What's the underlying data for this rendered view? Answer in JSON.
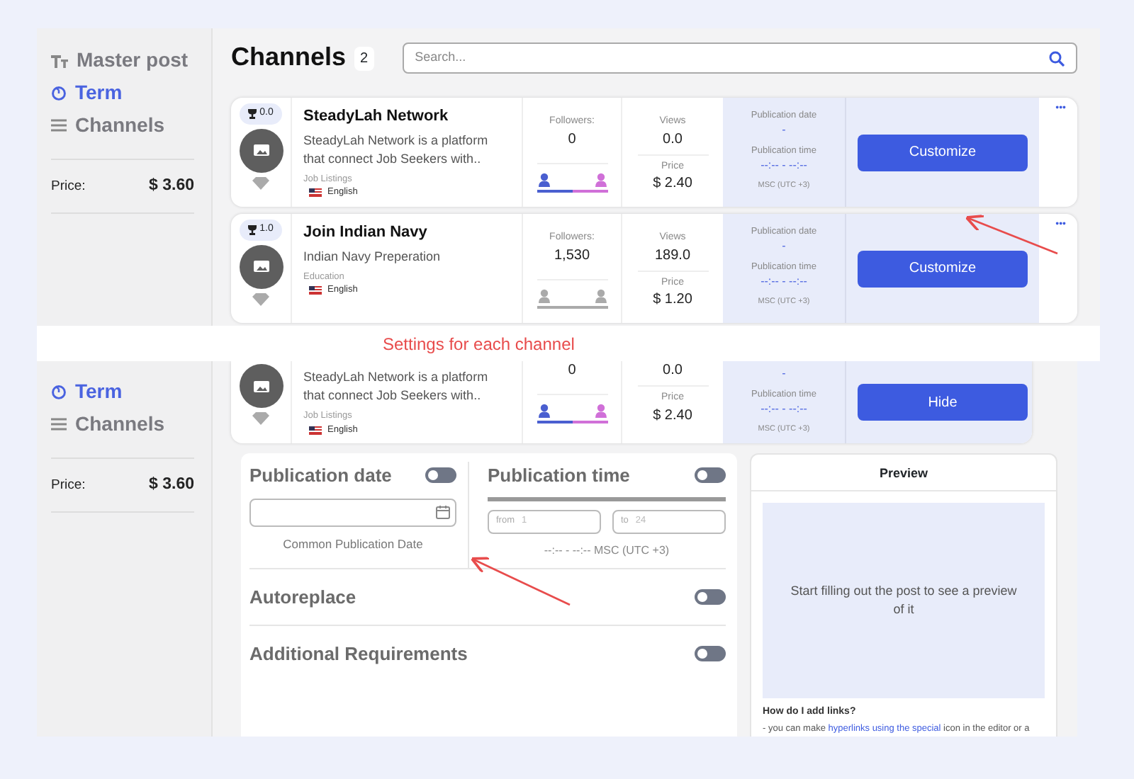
{
  "top_screen": {
    "sidebar": {
      "items": [
        {
          "kind": "text",
          "label": "Master post",
          "selected": false
        },
        {
          "kind": "timer",
          "label": "Term",
          "selected": true
        },
        {
          "kind": "list",
          "label": "Channels",
          "selected": false
        }
      ],
      "price_label": "Price:",
      "price_value": "$ 3.60"
    },
    "header": {
      "title": "Channels",
      "count": "2",
      "search_placeholder": "Search..."
    },
    "channels": [
      {
        "rating": "0.0",
        "name": "SteadyLah Network",
        "description": "SteadyLah Network is a platform that connect Job Seekers with..",
        "category": "Job Listings",
        "language": "English",
        "followers_label": "Followers:",
        "followers": "0",
        "audience_known": true,
        "level": 0.5,
        "views_label": "Views",
        "views": "0.0",
        "price_label": "Price",
        "price": "$ 2.40",
        "date_label": "Publication date",
        "date": "-",
        "time_label": "Publication time",
        "time": "--:-- - --:--",
        "timezone": "MSC (UTC +3)",
        "button": "Customize",
        "more": "•••"
      },
      {
        "rating": "1.0",
        "name": "Join Indian Navy",
        "description": "Indian Navy Preperation",
        "category": "Education",
        "language": "English",
        "followers_label": "Followers:",
        "followers": "1,530",
        "audience_known": false,
        "views_label": "Views",
        "views": "189.0",
        "price_label": "Price",
        "price": "$ 1.20",
        "date_label": "Publication date",
        "date": "-",
        "time_label": "Publication time",
        "time": "--:-- - --:--",
        "timezone": "MSC (UTC +3)",
        "button": "Customize",
        "more": "•••"
      }
    ]
  },
  "caption": "Settings for each channel",
  "bottom_screen": {
    "sidebar": {
      "items": [
        {
          "kind": "timer",
          "label": "Term",
          "selected": true
        },
        {
          "kind": "list",
          "label": "Channels",
          "selected": false
        }
      ],
      "price_label": "Price:",
      "price_value": "$ 3.60"
    },
    "channel": {
      "description": "SteadyLah Network is a platform that connect Job Seekers with..",
      "category": "Job Listings",
      "language": "English",
      "followers": "0",
      "audience_known": true,
      "level": 0.5,
      "views": "0.0",
      "price_label": "Price",
      "price": "$ 2.40",
      "date": "-",
      "time_label": "Publication time",
      "time": "--:-- - --:--",
      "timezone": "MSC (UTC +3)",
      "button": "Hide"
    },
    "settings": {
      "publication_date": {
        "title": "Publication date",
        "on": false,
        "caption": "Common Publication Date"
      },
      "publication_time": {
        "title": "Publication time",
        "on": false,
        "slider": {
          "level": 1
        },
        "from_label": "from",
        "from_placeholder": "1",
        "to_label": "to",
        "to_placeholder": "24",
        "summary": "--:-- - --:-- MSC (UTC +3)"
      },
      "toggles": [
        {
          "label": "Autoreplace",
          "on": false
        },
        {
          "label": "Additional Requirements",
          "on": false
        }
      ]
    },
    "preview": {
      "title": "Preview",
      "placeholder": "Start filling out the post to see a preview of it",
      "help_title": "How do I add links?",
      "help_text": "- you can make",
      "help_link": "hyperlinks using the special",
      "help_text_end": "icon in the editor or a"
    }
  }
}
